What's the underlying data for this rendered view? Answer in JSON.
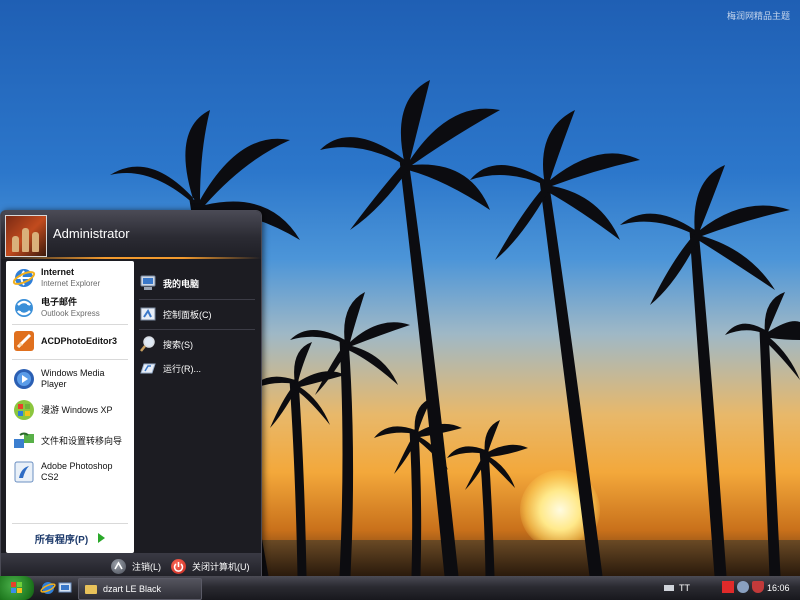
{
  "desktop": {
    "watermark": "梅润网精品主题"
  },
  "start_menu": {
    "username": "Administrator",
    "pinned": [
      {
        "title": "Internet",
        "subtitle": "Internet Explorer",
        "icon": "internet-explorer-icon"
      },
      {
        "title": "电子邮件",
        "subtitle": "Outlook Express",
        "icon": "outlook-express-icon"
      }
    ],
    "recent": [
      {
        "label": "ACDPhotoEditor3",
        "icon": "acdphotoeditor-icon"
      },
      {
        "label": "Windows Media Player",
        "icon": "media-player-icon"
      },
      {
        "label": "漫游 Windows XP",
        "icon": "windows-tour-icon"
      },
      {
        "label": "文件和设置转移向导",
        "icon": "transfer-wizard-icon"
      },
      {
        "label": "Adobe Photoshop CS2",
        "icon": "photoshop-icon"
      }
    ],
    "all_programs": "所有程序(P)",
    "places": [
      {
        "label": "我的电脑",
        "icon": "my-computer-icon"
      },
      {
        "label": "控制面板(C)",
        "icon": "control-panel-icon"
      },
      {
        "label": "搜索(S)",
        "icon": "search-icon"
      },
      {
        "label": "运行(R)...",
        "icon": "run-icon"
      }
    ],
    "logoff": "注销(L)",
    "shutdown": "关闭计算机(U)"
  },
  "taskbar": {
    "window_button": "dzart LE Black",
    "tray_text": "TT",
    "clock": "16:06"
  },
  "colors": {
    "accent_orange": "#f29a2e",
    "menu_dark": "#1c1c22",
    "start_green": "#2aa82a"
  }
}
